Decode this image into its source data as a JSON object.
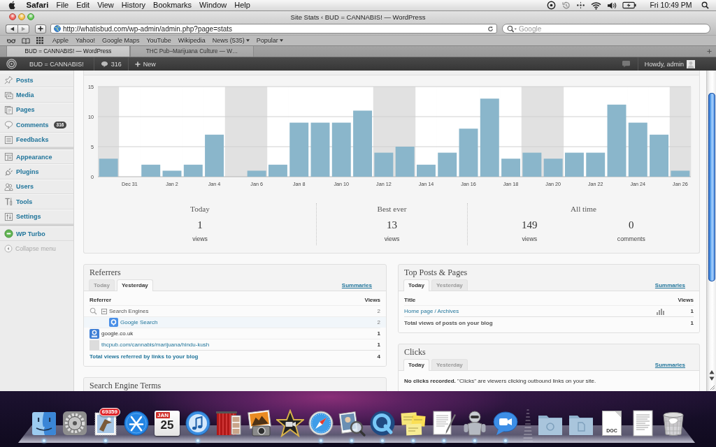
{
  "menu_bar": {
    "app": "Safari",
    "menus": [
      "File",
      "Edit",
      "View",
      "History",
      "Bookmarks",
      "Window",
      "Help"
    ],
    "clock": "Fri 10:49 PM"
  },
  "browser": {
    "title": "Site Stats ‹ BUD = CANNABIS! — WordPress",
    "address": "http://whatisbud.com/wp-admin/admin.php?page=stats",
    "search": {
      "placeholder": "Google"
    },
    "bookmarks": [
      {
        "label": "Apple",
        "kind": "link"
      },
      {
        "label": "Yahoo!",
        "kind": "link"
      },
      {
        "label": "Google Maps",
        "kind": "link"
      },
      {
        "label": "YouTube",
        "kind": "link"
      },
      {
        "label": "Wikipedia",
        "kind": "link"
      },
      {
        "label": "News (535)",
        "kind": "menu"
      },
      {
        "label": "Popular",
        "kind": "menu"
      }
    ],
    "tabs": [
      {
        "label": "BUD = CANNABIS! — WordPress",
        "selected": true
      },
      {
        "label": "THC Pub–Marijuana Culture — W…",
        "selected": false
      }
    ]
  },
  "admin_bar": {
    "site": "BUD = CANNABIS!",
    "comments": "316",
    "new": "New",
    "greeting": "Howdy, admin"
  },
  "sidebar": {
    "groups": [
      {
        "items": [
          {
            "label": "Posts",
            "selected": false
          },
          {
            "label": "Media",
            "selected": false
          },
          {
            "label": "Pages",
            "selected": false
          },
          {
            "label": "Comments",
            "badge": "316",
            "selected": false
          },
          {
            "label": "Feedbacks",
            "selected": false
          }
        ]
      },
      {
        "items": [
          {
            "label": "Appearance",
            "selected": false
          },
          {
            "label": "Plugins",
            "selected": false
          },
          {
            "label": "Users",
            "selected": false
          },
          {
            "label": "Tools",
            "selected": false
          },
          {
            "label": "Settings",
            "selected": false
          }
        ]
      },
      {
        "items": [
          {
            "label": "WP Turbo",
            "selected": false
          }
        ]
      }
    ],
    "collapse": "Collapse menu"
  },
  "stats": {
    "chart_data": {
      "type": "bar",
      "categories": [
        null,
        "Dec 31",
        null,
        "Jan 2",
        null,
        "Jan 4",
        null,
        "Jan 6",
        null,
        "Jan 8",
        null,
        "Jan 10",
        null,
        "Jan 12",
        null,
        "Jan 14",
        null,
        "Jan 16",
        null,
        "Jan 18",
        null,
        "Jan 20",
        null,
        "Jan 22",
        null,
        "Jan 24",
        null,
        "Jan 26"
      ],
      "values": [
        3,
        0,
        2,
        1,
        2,
        7,
        0,
        1,
        2,
        9,
        9,
        9,
        11,
        4,
        5,
        2,
        4,
        8,
        13,
        3,
        4,
        3,
        4,
        4,
        12,
        9,
        7,
        1
      ],
      "ylim": [
        0,
        15
      ],
      "yticks": [
        0,
        5,
        10,
        15
      ]
    },
    "day_columns": [
      {
        "shaded": true
      },
      {
        "shaded": false
      },
      {
        "shaded": false
      },
      {
        "shaded": false
      },
      {
        "shaded": false
      },
      {
        "shaded": false
      },
      {
        "shaded": true
      },
      {
        "shaded": true
      },
      {
        "shaded": false
      },
      {
        "shaded": false
      },
      {
        "shaded": false
      },
      {
        "shaded": false
      },
      {
        "shaded": false
      },
      {
        "shaded": true
      },
      {
        "shaded": true
      },
      {
        "shaded": false
      },
      {
        "shaded": false
      },
      {
        "shaded": false
      },
      {
        "shaded": false
      },
      {
        "shaded": false
      },
      {
        "shaded": true
      },
      {
        "shaded": true
      },
      {
        "shaded": false
      },
      {
        "shaded": false
      },
      {
        "shaded": false
      },
      {
        "shaded": false
      },
      {
        "shaded": false
      },
      {
        "shaded": true
      }
    ],
    "summary": [
      {
        "heading": "Today",
        "figures": [
          {
            "number": "1",
            "unit": "views"
          }
        ]
      },
      {
        "heading": "Best ever",
        "figures": [
          {
            "number": "13",
            "unit": "views"
          }
        ]
      },
      {
        "heading": "All time",
        "figures": [
          {
            "number": "149",
            "unit": "views"
          },
          {
            "number": "0",
            "unit": "comments"
          }
        ]
      }
    ]
  },
  "referrers": {
    "title": "Referrers",
    "tabs": [
      {
        "label": "Today",
        "selected": false
      },
      {
        "label": "Yesterday",
        "selected": true
      }
    ],
    "summaries": "Summaries",
    "columns": [
      "Referrer",
      "Views"
    ],
    "rows": [
      {
        "kind": "group",
        "label": "Search Engines",
        "views": "2",
        "expanded": true,
        "children": [
          {
            "kind": "engine",
            "label": "Google Search",
            "views": "2"
          }
        ]
      },
      {
        "kind": "site",
        "label": "google.co.uk",
        "views": "1",
        "has_favicon": true,
        "link": false
      },
      {
        "kind": "site",
        "label": "thcpub.com/cannabis/marijuana/hindu-kush",
        "views": "1",
        "has_favicon": false,
        "link": true
      }
    ],
    "total": {
      "label": "Total views referred by links to your blog",
      "views": "4"
    }
  },
  "search_terms": {
    "title": "Search Engine Terms"
  },
  "top_posts": {
    "title": "Top Posts & Pages",
    "tabs": [
      {
        "label": "Today",
        "selected": true
      },
      {
        "label": "Yesterday",
        "selected": false
      }
    ],
    "summaries": "Summaries",
    "columns": [
      "Title",
      "Views"
    ],
    "rows": [
      {
        "kind": "post",
        "label": "Home page / Archives",
        "views": "1"
      }
    ],
    "total": {
      "label": "Total views of posts on your blog",
      "views": "1"
    }
  },
  "clicks": {
    "title": "Clicks",
    "tabs": [
      {
        "label": "Today",
        "selected": true
      },
      {
        "label": "Yesterday",
        "selected": false
      }
    ],
    "summaries": "Summaries",
    "message": "**No clicks recorded.** \"Clicks\" are viewers clicking outbound links on your site."
  },
  "dock": {
    "apps": [
      {
        "kind": "app",
        "running": true
      },
      {
        "kind": "app",
        "running": false
      },
      {
        "kind": "app",
        "badge": "69359",
        "running": true
      },
      {
        "kind": "app",
        "running": false
      },
      {
        "kind": "calendar",
        "month": "JAN",
        "day": "25",
        "running": false
      },
      {
        "kind": "app",
        "running": true
      },
      {
        "kind": "app",
        "running": false
      },
      {
        "kind": "app",
        "running": false
      },
      {
        "kind": "app",
        "running": false
      },
      {
        "kind": "app",
        "running": true
      },
      {
        "kind": "app",
        "running": true
      },
      {
        "kind": "app",
        "running": true
      },
      {
        "kind": "app",
        "running": true
      },
      {
        "kind": "app",
        "running": true
      },
      {
        "kind": "app",
        "running": true
      },
      {
        "kind": "app",
        "running": true
      }
    ],
    "stacks": [
      {
        "kind": "folder"
      },
      {
        "kind": "folder"
      },
      {
        "kind": "file",
        "label": "DOC"
      },
      {
        "kind": "document"
      },
      {
        "kind": "trash"
      }
    ]
  }
}
